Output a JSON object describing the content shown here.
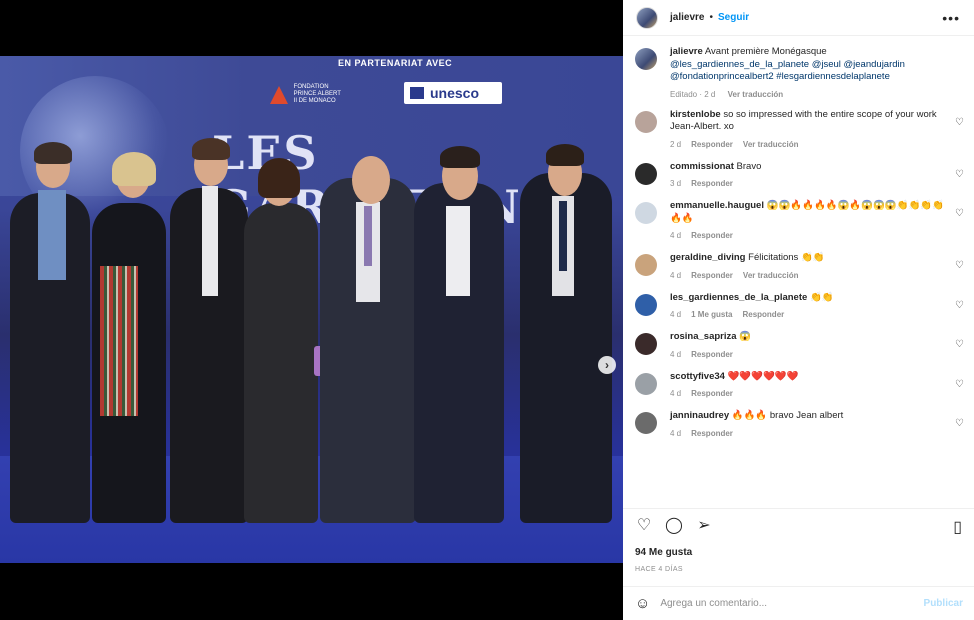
{
  "media": {
    "backdrop_partner_text": "EN PARTENARIAT AVEC",
    "backdrop_foundation_text": "FONDATION PRINCE ALBERT II DE MONACO",
    "backdrop_unesco_text": "unesco",
    "backdrop_title": "LES GARDIENNES",
    "carousel_count": 2,
    "carousel_active": 0
  },
  "header": {
    "username": "jalievre",
    "separator": "•",
    "follow_label": "Seguir",
    "more_icon": "more-horizontal-icon"
  },
  "caption": {
    "username": "jalievre",
    "text": "Avant première Monégasque",
    "mentions": "@les_gardiennes_de_la_planete @jseul @jeandujardin @fondationprincealbert2 #lesgardiennesdelaplanete",
    "edited": "Editado · 2 d",
    "translate": "Ver traducción"
  },
  "comments": [
    {
      "username": "kirstenlobe",
      "text": "so so impressed with the entire scope of your work Jean-Albert. xo",
      "age": "2 d",
      "reply": "Responder",
      "translate": "Ver traducción",
      "likes": "",
      "avatar_color": "#b8a39a"
    },
    {
      "username": "commissionat",
      "text": "Bravo",
      "age": "3 d",
      "reply": "Responder",
      "translate": "",
      "likes": "",
      "avatar_color": "#2a2a2a"
    },
    {
      "username": "emmanuelle.hauguel",
      "text": "😱😱🔥🔥🔥🔥😱🔥😱😱😱👏👏👏👏🔥🔥",
      "age": "4 d",
      "reply": "Responder",
      "translate": "",
      "likes": "",
      "avatar_color": "#cfd8e2"
    },
    {
      "username": "geraldine_diving",
      "text": "Félicitations 👏👏",
      "age": "4 d",
      "reply": "Responder",
      "translate": "Ver traducción",
      "likes": "",
      "avatar_color": "#c9a37c"
    },
    {
      "username": "les_gardiennes_de_la_planete",
      "text": "👏👏",
      "age": "4 d",
      "reply": "Responder",
      "translate": "",
      "likes": "1 Me gusta",
      "avatar_color": "#2f5fa8"
    },
    {
      "username": "rosina_saprizа",
      "text": "😱",
      "age": "4 d",
      "reply": "Responder",
      "translate": "",
      "likes": "",
      "avatar_color": "#3a2a2a"
    },
    {
      "username": "scottyfive34",
      "text": "❤️❤️❤️❤️❤️❤️",
      "age": "4 d",
      "reply": "Responder",
      "translate": "",
      "likes": "",
      "avatar_color": "#9aa0a6"
    },
    {
      "username": "janninaudrey",
      "text": "🔥🔥🔥 bravo Jean albert",
      "age": "4 d",
      "reply": "Responder",
      "translate": "",
      "likes": "",
      "avatar_color": "#6b6b6b"
    }
  ],
  "actions": {
    "like_icon": "heart-icon",
    "comment_icon": "comment-icon",
    "share_icon": "send-icon",
    "save_icon": "bookmark-icon",
    "likes": "94 Me gusta",
    "date": "HACE 4 DÍAS"
  },
  "add_comment": {
    "placeholder": "Agrega un comentario...",
    "publish_label": "Publicar"
  }
}
